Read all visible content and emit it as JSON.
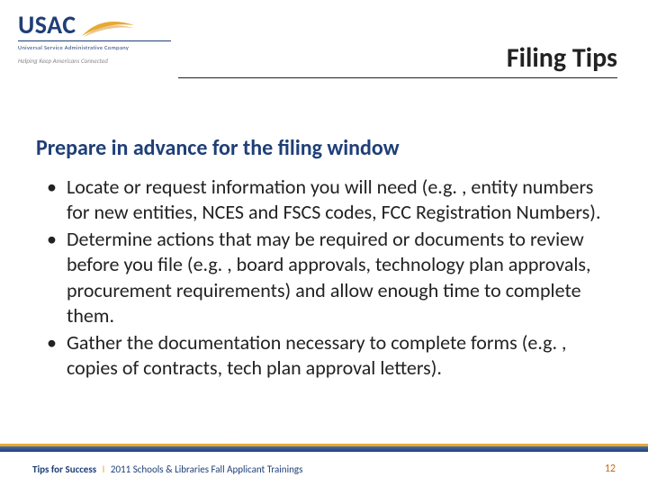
{
  "logo": {
    "acronym": "USAC",
    "subline": "Universal Service Administrative Company",
    "tagline": "Helping Keep Americans Connected"
  },
  "title": "Filing Tips",
  "section_heading": "Prepare in advance for the filing window",
  "bullets": [
    "Locate or request information you will need (e.g. , entity numbers for new entities, NCES and FSCS codes, FCC Registration Numbers).",
    "Determine actions that may be required or documents to review before you file (e.g. , board approvals, technology plan approvals, procurement requirements) and allow enough time to complete them.",
    "Gather the documentation necessary to complete forms (e.g. , copies of contracts, tech plan approval letters)."
  ],
  "footer": {
    "left_bold": "Tips for Success",
    "left_rest": "2011 Schools & Libraries Fall Applicant Trainings",
    "page": "12"
  }
}
